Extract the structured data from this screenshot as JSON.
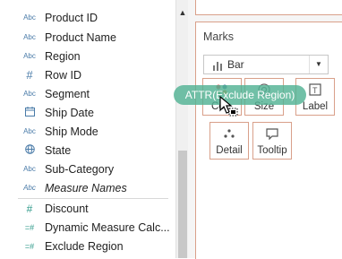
{
  "fields": [
    {
      "type_icon": "Abc",
      "kind": "dimension-string",
      "name": "Product ID"
    },
    {
      "type_icon": "Abc",
      "kind": "dimension-string",
      "name": "Product Name"
    },
    {
      "type_icon": "Abc",
      "kind": "dimension-string",
      "name": "Region"
    },
    {
      "type_icon": "#",
      "kind": "dimension-number",
      "name": "Row ID"
    },
    {
      "type_icon": "Abc",
      "kind": "dimension-string",
      "name": "Segment"
    },
    {
      "type_icon": "calendar",
      "kind": "dimension-date",
      "name": "Ship Date"
    },
    {
      "type_icon": "Abc",
      "kind": "dimension-string",
      "name": "Ship Mode"
    },
    {
      "type_icon": "globe",
      "kind": "dimension-geo",
      "name": "State"
    },
    {
      "type_icon": "Abc",
      "kind": "dimension-string",
      "name": "Sub-Category"
    },
    {
      "type_icon": "Abc",
      "kind": "dimension-string",
      "name": "Measure Names",
      "italic": true
    },
    {
      "type_icon": "#",
      "kind": "measure",
      "name": "Discount"
    },
    {
      "type_icon": "=#",
      "kind": "measure-calc",
      "name": "Dynamic Measure Calc..."
    },
    {
      "type_icon": "=#",
      "kind": "measure-calc",
      "name": "Exclude Region"
    }
  ],
  "marks": {
    "title": "Marks",
    "mark_type": "Bar",
    "buttons": {
      "color": {
        "label": "Co",
        "icon": "color-dots-icon"
      },
      "size": {
        "label": "Size",
        "icon": "size-icon"
      },
      "label": {
        "label": "Label",
        "icon": "label-icon"
      },
      "detail": {
        "label": "Detail",
        "icon": "detail-icon"
      },
      "tooltip": {
        "label": "Tooltip",
        "icon": "tooltip-icon"
      }
    }
  },
  "drag_pill": {
    "text": "ATTR(Exclude Region)"
  },
  "colors": {
    "marks_border": "#d9a08a",
    "pill": "#52b294",
    "dimension_icon": "#4a7ba8",
    "measure_icon": "#2f9a8a"
  }
}
